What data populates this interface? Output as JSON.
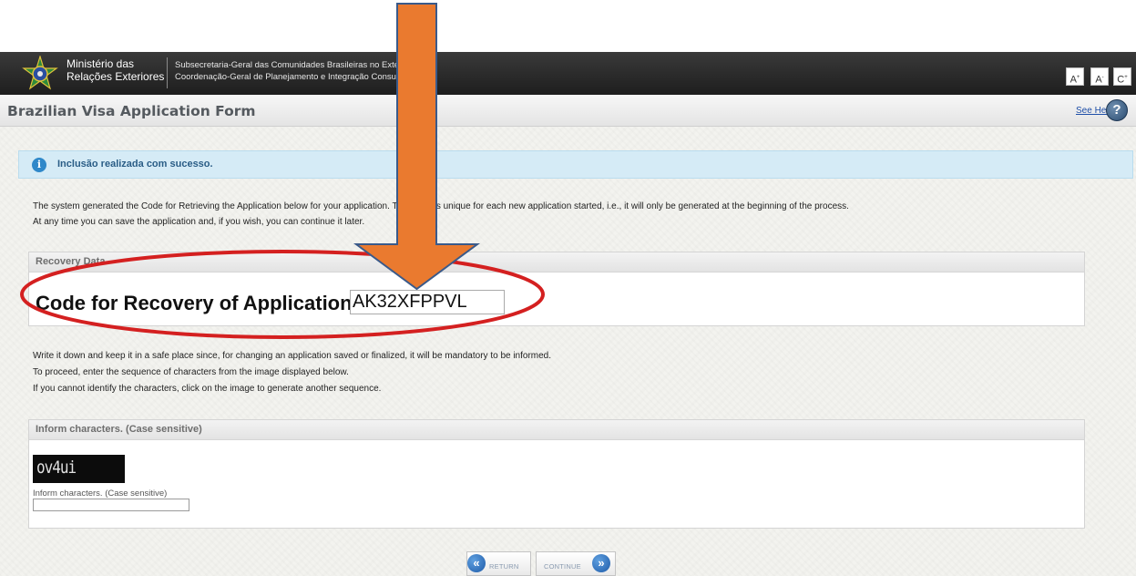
{
  "header": {
    "ministry_line1": "Ministério das",
    "ministry_line2": "Relações Exteriores",
    "subsec_line1": "Subsecretaria-Geral das Comunidades Brasileiras no Exterior",
    "subsec_line2": "Coordenação-Geral de Planejamento e Integração Consular",
    "font_increase": "A",
    "font_decrease": "A",
    "font_reset": "C"
  },
  "title_bar": {
    "title": "Brazilian Visa Application Form",
    "see_help": "See Help",
    "help_icon_glyph": "?"
  },
  "notice": {
    "icon_glyph": "i",
    "text": "Inclusão realizada com sucesso."
  },
  "intro": {
    "line1": "The system generated the Code for Retrieving the Application below for your application. This code is unique for each new application started, i.e., it will only be generated at the beginning of the process.",
    "line2": "At any time you can save the application and, if you wish, you can continue it later."
  },
  "recovery": {
    "panel_title": "Recovery Data",
    "code_label": "Code for Recovery of Application",
    "code_value": "AK32XFPPVL"
  },
  "instructions": {
    "line1": "Write it down and keep it in a safe place since, for changing an application saved or finalized, it will be mandatory to be informed.",
    "line2": "To proceed, enter the sequence of characters from the image displayed below.",
    "line3": "If you cannot identify the characters, click on the image to generate another sequence."
  },
  "captcha": {
    "panel_title": "Inform characters. (Case sensitive)",
    "image_text": "ov4ui",
    "field_label": "Inform characters. (Case sensitive)",
    "field_value": ""
  },
  "buttons": {
    "return_label": "RETURN",
    "continue_label": "CONTINUE",
    "return_icon": "«",
    "continue_icon": "»"
  },
  "colors": {
    "header_bg": "#2a2a2a",
    "notice_bg": "#d5ebf6",
    "link": "#1f4fa8",
    "annotation_arrow": "#ea7a2f",
    "annotation_ellipse": "#d42020"
  }
}
